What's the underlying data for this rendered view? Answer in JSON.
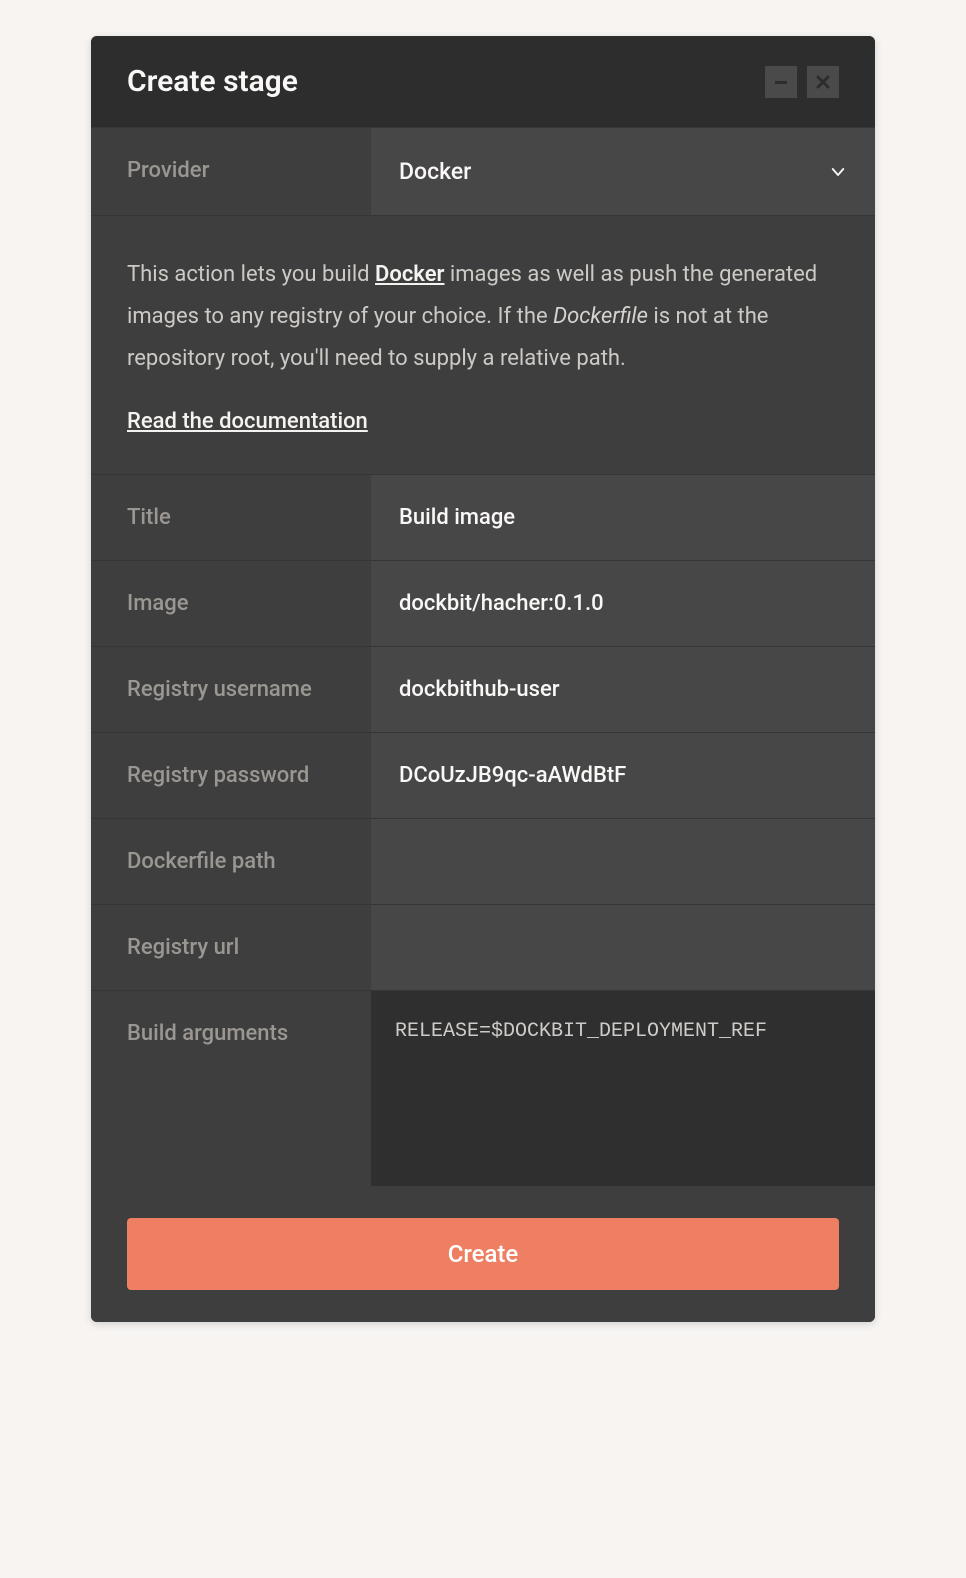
{
  "header": {
    "title": "Create stage"
  },
  "provider": {
    "label": "Provider",
    "value": "Docker"
  },
  "description": {
    "text_prefix": "This action lets you build ",
    "link_docker": "Docker",
    "text_middle": " images as well as push the generated images to any registry of your choice. If the ",
    "italic_dockerfile": "Dockerfile",
    "text_suffix": " is not at the repository root, you'll need to supply a relative path.",
    "doc_link": "Read the documentation"
  },
  "fields": {
    "title": {
      "label": "Title",
      "value": "Build image"
    },
    "image": {
      "label": "Image",
      "value": "dockbit/hacher:0.1.0"
    },
    "registry_username": {
      "label": "Registry username",
      "value": "dockbithub-user"
    },
    "registry_password": {
      "label": "Registry password",
      "value": "DCoUzJB9qc-aAWdBtF"
    },
    "dockerfile_path": {
      "label": "Dockerfile path",
      "value": ""
    },
    "registry_url": {
      "label": "Registry url",
      "value": ""
    },
    "build_arguments": {
      "label": "Build arguments",
      "value": "RELEASE=$DOCKBIT_DEPLOYMENT_REF"
    }
  },
  "footer": {
    "create_label": "Create"
  }
}
